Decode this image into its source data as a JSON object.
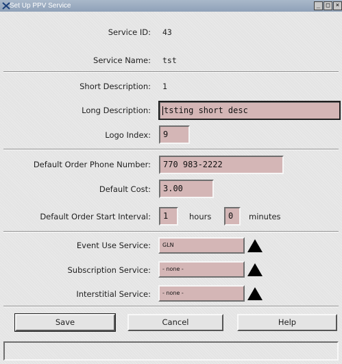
{
  "window": {
    "title": "Set Up PPV Service",
    "controls": [
      "_",
      "□",
      "×"
    ]
  },
  "service": {
    "id_label": "Service ID:",
    "id_value": "43",
    "name_label": "Service Name:",
    "name_value": "tst",
    "short_desc_label": "Short Description:",
    "short_desc_value": "1",
    "long_desc_label": "Long Description:",
    "long_desc_value": "tsting short desc",
    "logo_label": "Logo Index:",
    "logo_value": "9"
  },
  "defaults": {
    "phone_label": "Default Order Phone Number:",
    "phone_value": "770 983-2222",
    "cost_label": "Default Cost:",
    "cost_value": "3.00",
    "interval_label": "Default Order Start Interval:",
    "hours_value": "1",
    "hours_unit": "hours",
    "minutes_value": "0",
    "minutes_unit": "minutes"
  },
  "related": {
    "event_label": "Event Use Service:",
    "event_value": "GLN",
    "subscription_label": "Subscription Service:",
    "subscription_value": "- none -",
    "interstitial_label": "Interstitial Service:",
    "interstitial_value": "- none -"
  },
  "buttons": {
    "save": "Save",
    "cancel": "Cancel",
    "help": "Help"
  },
  "status": {
    "text": ""
  }
}
